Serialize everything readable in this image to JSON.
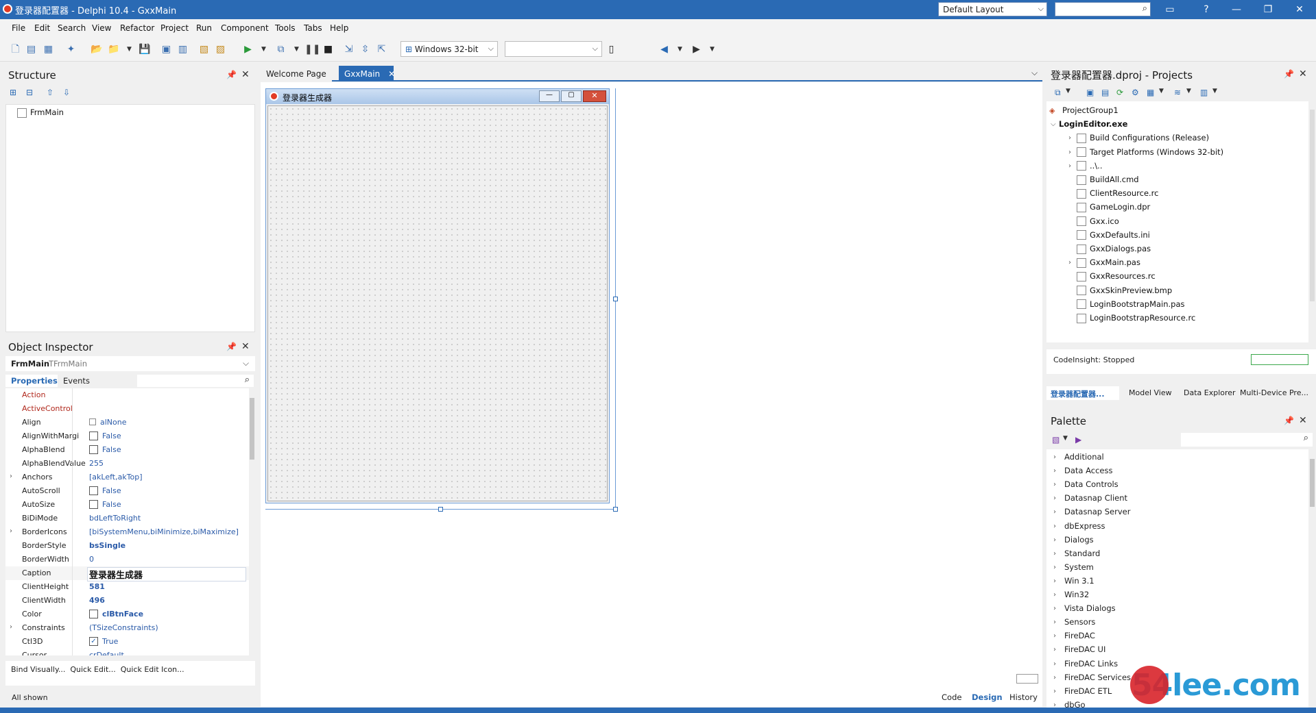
{
  "titlebar": {
    "title": "登录器配置器 - Delphi 10.4 - GxxMain",
    "layout_combo": "Default Layout",
    "minimize": "—",
    "maximize": "❐",
    "close": "✕",
    "help": "?"
  },
  "menu": [
    "File",
    "Edit",
    "Search",
    "View",
    "Refactor",
    "Project",
    "Run",
    "Component",
    "Tools",
    "Tabs",
    "Help"
  ],
  "toolbar": {
    "platform_combo": "Windows 32-bit",
    "config_combo": ""
  },
  "structure": {
    "title": "Structure",
    "tree": [
      "FrmMain"
    ]
  },
  "object_inspector": {
    "title": "Object Inspector",
    "object_name": "FrmMain",
    "object_type": "TFrmMain",
    "tabs": [
      "Properties",
      "Events"
    ],
    "properties": [
      {
        "name": "Action",
        "value": "",
        "red": true
      },
      {
        "name": "ActiveControl",
        "value": "",
        "red": true
      },
      {
        "name": "Align",
        "value": "alNone",
        "icon": "align"
      },
      {
        "name": "AlignWithMargi",
        "value": "False",
        "check": false
      },
      {
        "name": "AlphaBlend",
        "value": "False",
        "check": false
      },
      {
        "name": "AlphaBlendValue",
        "value": "255"
      },
      {
        "name": "Anchors",
        "value": "[akLeft,akTop]",
        "expand": true
      },
      {
        "name": "AutoScroll",
        "value": "False",
        "check": false
      },
      {
        "name": "AutoSize",
        "value": "False",
        "check": false
      },
      {
        "name": "BiDiMode",
        "value": "bdLeftToRight"
      },
      {
        "name": "BorderIcons",
        "value": "[biSystemMenu,biMinimize,biMaximize]",
        "expand": true
      },
      {
        "name": "BorderStyle",
        "value": "bsSingle",
        "bold": true
      },
      {
        "name": "BorderWidth",
        "value": "0"
      },
      {
        "name": "Caption",
        "value": "登录器生成器",
        "bold": true,
        "dark": true,
        "selected": true
      },
      {
        "name": "ClientHeight",
        "value": "581",
        "bold": true
      },
      {
        "name": "ClientWidth",
        "value": "496",
        "bold": true
      },
      {
        "name": "Color",
        "value": "clBtnFace",
        "bold": true,
        "check": false
      },
      {
        "name": "Constraints",
        "value": "(TSizeConstraints)",
        "expand": true
      },
      {
        "name": "Ctl3D",
        "value": "True",
        "check": true
      },
      {
        "name": "Cursor",
        "value": "crDefault"
      }
    ],
    "bind_links": "Bind Visually...  Quick Edit...  Quick Edit Icon...",
    "footer": "All shown"
  },
  "editor": {
    "tabs": [
      "Welcome Page",
      "GxxMain"
    ],
    "active_tab": "GxxMain",
    "form_caption": "登录器生成器",
    "bottom_tabs": [
      "Code",
      "Design",
      "History"
    ]
  },
  "projects": {
    "title": "登录器配置器.dproj - Projects",
    "tree": [
      {
        "label": "ProjectGroup1",
        "level": 0
      },
      {
        "label": "LoginEditor.exe",
        "level": 1,
        "bold": true,
        "expanded": true
      },
      {
        "label": "Build Configurations (Release)",
        "level": 2,
        "expand": true
      },
      {
        "label": "Target Platforms (Windows 32-bit)",
        "level": 2,
        "expand": true
      },
      {
        "label": "..\\..",
        "level": 2,
        "expand": true
      },
      {
        "label": "BuildAll.cmd",
        "level": 2
      },
      {
        "label": "ClientResource.rc",
        "level": 2
      },
      {
        "label": "GameLogin.dpr",
        "level": 2
      },
      {
        "label": "Gxx.ico",
        "level": 2
      },
      {
        "label": "GxxDefaults.ini",
        "level": 2
      },
      {
        "label": "GxxDialogs.pas",
        "level": 2
      },
      {
        "label": "GxxMain.pas",
        "level": 2,
        "expand": true
      },
      {
        "label": "GxxResources.rc",
        "level": 2
      },
      {
        "label": "GxxSkinPreview.bmp",
        "level": 2
      },
      {
        "label": "LoginBootstrapMain.pas",
        "level": 2
      },
      {
        "label": "LoginBootstrapResource.rc",
        "level": 2
      }
    ],
    "codeinsight": "CodeInsight: Stopped",
    "tabs": [
      "登录器配置器...",
      "Model View",
      "Data Explorer",
      "Multi-Device Pre..."
    ]
  },
  "palette": {
    "title": "Palette",
    "items": [
      "Additional",
      "Data Access",
      "Data Controls",
      "Datasnap Client",
      "Datasnap Server",
      "dbExpress",
      "Dialogs",
      "Standard",
      "System",
      "Win 3.1",
      "Win32",
      "Vista Dialogs",
      "Sensors",
      "FireDAC",
      "FireDAC UI",
      "FireDAC Links",
      "FireDAC Services",
      "FireDAC ETL",
      "dbGo"
    ]
  },
  "watermark": "54lee.com",
  "colors": {
    "accent": "#2a6ab4",
    "prop_red": "#b0281c",
    "value_blue": "#2a5aa8"
  }
}
